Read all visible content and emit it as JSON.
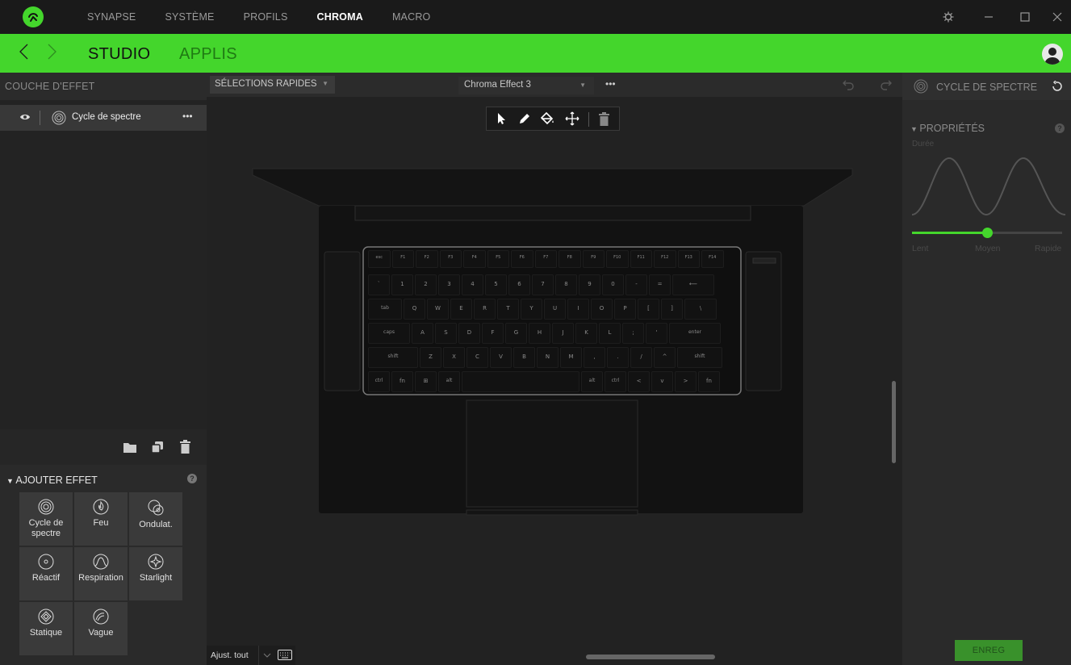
{
  "titlebar": {
    "nav": [
      "SYNAPSE",
      "SYSTÈME",
      "PROFILS",
      "CHROMA",
      "MACRO"
    ],
    "active": "CHROMA"
  },
  "subnav": {
    "tabs": [
      "STUDIO",
      "APPLIS"
    ],
    "active": "STUDIO"
  },
  "left": {
    "header": "COUCHE D'EFFET",
    "layer": {
      "name": "Cycle de spectre",
      "menu": "•••"
    },
    "add_effect": {
      "title": "AJOUTER EFFET",
      "help": "?",
      "effects": [
        {
          "label": "Cycle de spectre",
          "icon": "spectrum-cycle-icon"
        },
        {
          "label": "Feu",
          "icon": "fire-icon"
        },
        {
          "label": "Ondulat.",
          "icon": "ripple-icon"
        },
        {
          "label": "Réactif",
          "icon": "reactive-icon"
        },
        {
          "label": "Respiration",
          "icon": "breathing-icon"
        },
        {
          "label": "Starlight",
          "icon": "starlight-icon"
        },
        {
          "label": "Statique",
          "icon": "static-icon"
        },
        {
          "label": "Vague",
          "icon": "wave-icon"
        }
      ]
    }
  },
  "center": {
    "quick_select": "SÉLECTIONS RAPIDES",
    "effect_name": "Chroma Effect 3",
    "effect_menu": "•••",
    "fit_all": "Ajust. tout",
    "keyboard": {
      "rows": [
        [
          "esc",
          "F1",
          "F2",
          "F3",
          "F4",
          "F5",
          "F6",
          "F7",
          "F8",
          "F9",
          "F10",
          "F11",
          "F12",
          "F13",
          "F14"
        ],
        [
          "`",
          "1",
          "2",
          "3",
          "4",
          "5",
          "6",
          "7",
          "8",
          "9",
          "0",
          "-",
          "=",
          "⟵"
        ],
        [
          "tab",
          "Q",
          "W",
          "E",
          "R",
          "T",
          "Y",
          "U",
          "I",
          "O",
          "P",
          "[",
          "]",
          "\\"
        ],
        [
          "caps",
          "A",
          "S",
          "D",
          "F",
          "G",
          "H",
          "J",
          "K",
          "L",
          ";",
          "'",
          "enter"
        ],
        [
          "shift",
          "Z",
          "X",
          "C",
          "V",
          "B",
          "N",
          "M",
          ",",
          ".",
          "/",
          "^",
          "shift"
        ],
        [
          "ctrl",
          "fn",
          "⊞",
          "alt",
          "",
          "alt",
          "ctrl",
          "<",
          "v",
          ">",
          "fn"
        ]
      ]
    }
  },
  "right": {
    "header": "CYCLE DE SPECTRE",
    "properties": "PROPRIÉTÉS",
    "help": "?",
    "duration_label": "Durée",
    "speed_labels": [
      "Lent",
      "Moyen",
      "Rapide"
    ],
    "speed_value": 0.5,
    "save": "ENREG"
  },
  "colors": {
    "accent": "#44d62c",
    "bg": "#222222"
  }
}
